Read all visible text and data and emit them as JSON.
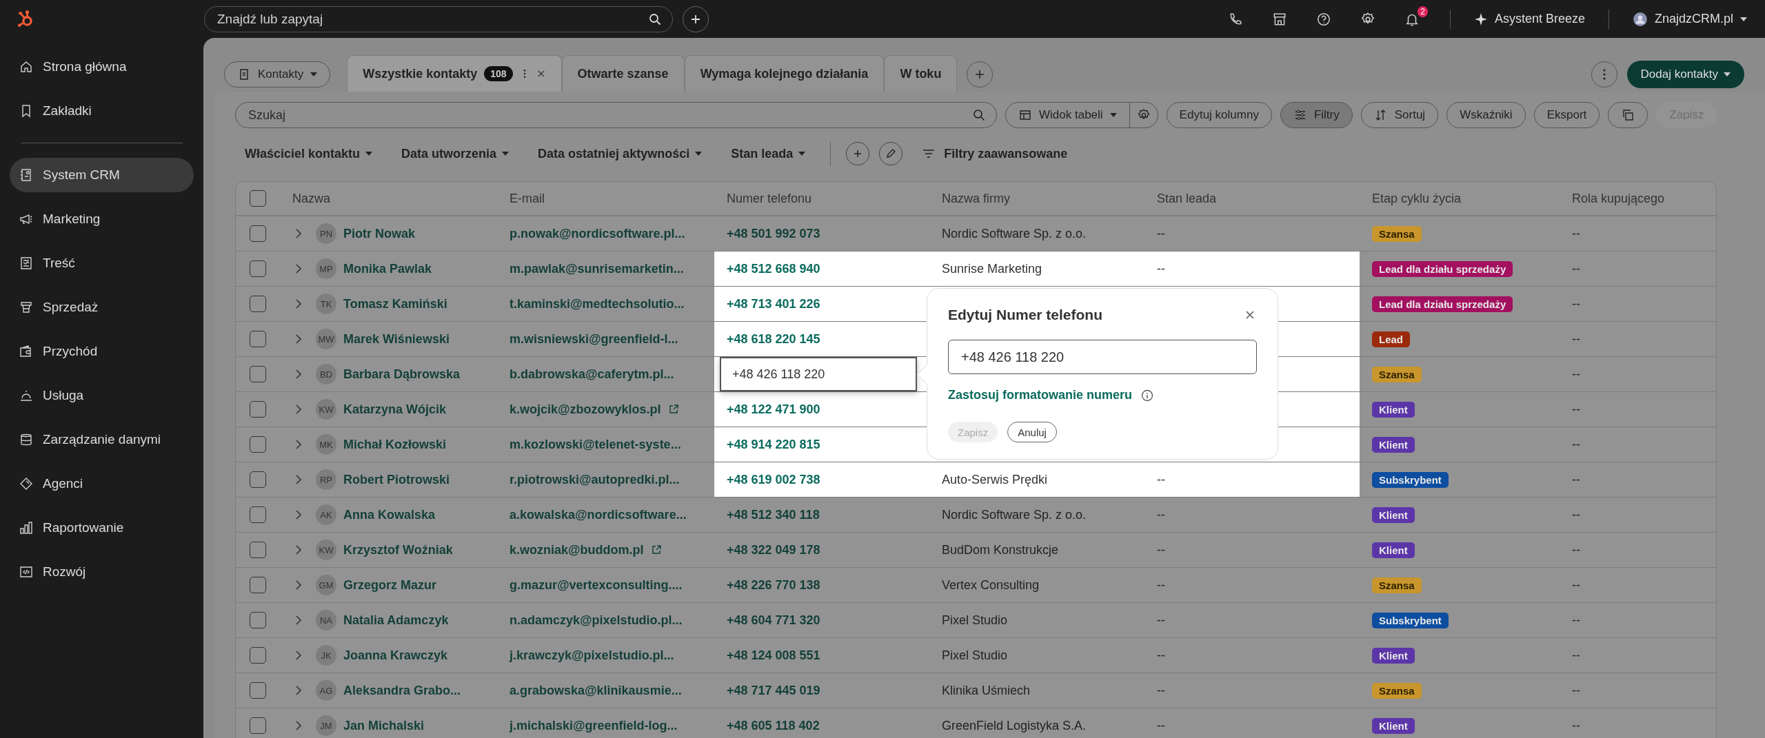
{
  "top_bar": {
    "search": {
      "placeholder": "Znajdź lub zapytaj"
    },
    "notifications": "2",
    "assistant": "Asystent Breeze",
    "account": "ZnajdzCRM.pl"
  },
  "sidebar": {
    "top_items": [
      {
        "label": "Strona główna",
        "selected": false
      },
      {
        "label": "Zakładki",
        "selected": false
      }
    ],
    "items": [
      {
        "label": "System CRM",
        "selected": true
      },
      {
        "label": "Marketing",
        "selected": false
      },
      {
        "label": "Treść",
        "selected": false
      },
      {
        "label": "Sprzedaż",
        "selected": false
      },
      {
        "label": "Przychód",
        "selected": false
      },
      {
        "label": "Usługa",
        "selected": false
      },
      {
        "label": "Zarządzanie danymi",
        "selected": false
      },
      {
        "label": "Agenci",
        "selected": false
      },
      {
        "label": "Raportowanie",
        "selected": false
      },
      {
        "label": "Rozwój",
        "selected": false
      }
    ]
  },
  "object_selector": "Kontakty",
  "tabs": [
    {
      "label": "Wszystkie kontakty",
      "count": "108",
      "selected": true
    },
    {
      "label": "Otwarte szanse",
      "selected": false
    },
    {
      "label": "Wymaga kolejnego działania",
      "selected": false
    },
    {
      "label": "W toku",
      "selected": false
    }
  ],
  "add_button": "Dodaj kontakty",
  "toolbar": {
    "search": {
      "placeholder": "Szukaj"
    },
    "view": "Widok tabeli",
    "buttons": [
      {
        "label": "Edytuj kolumny",
        "selected": false
      },
      {
        "label": "Filtry",
        "selected": true
      },
      {
        "label": "Sortuj",
        "selected": false
      },
      {
        "label": "Wskaźniki",
        "selected": false
      },
      {
        "label": "Eksport",
        "selected": false
      }
    ],
    "save": {
      "label": "Zapisz",
      "disabled": true
    }
  },
  "filters": [
    "Właściciel kontaktu",
    "Data utworzenia",
    "Data ostatniej aktywności",
    "Stan leada"
  ],
  "advanced_filters": "Filtry zaawansowane",
  "table": {
    "select_all_checked": false,
    "columns": [
      "Nazwa",
      "E-mail",
      "Numer telefonu",
      "Nazwa firmy",
      "Stan leada",
      "Etap cyklu życia",
      "Rola kupującego"
    ],
    "rows": [
      {
        "checked": false,
        "initials": "PN",
        "name": "Piotr Nowak",
        "email": "p.nowak@nordicsoftware.pl...",
        "external": false,
        "phone": "+48 501 992 073",
        "company": "Nordic Software Sp. z o.o.",
        "lead_status": "--",
        "stage": {
          "label": "Szansa",
          "color": "#c8962c"
        },
        "role": "--",
        "highlighted": false,
        "editing": false
      },
      {
        "checked": false,
        "initials": "MP",
        "name": "Monika Pawlak",
        "email": "m.pawlak@sunrisemarketin...",
        "external": false,
        "phone": "+48 512 668 940",
        "company": "Sunrise Marketing",
        "lead_status": "--",
        "stage": {
          "label": "Lead dla działu sprzedaży",
          "color": "#a3105f"
        },
        "role": "--",
        "highlighted": true,
        "editing": false
      },
      {
        "checked": false,
        "initials": "TK",
        "name": "Tomasz Kamiński",
        "email": "t.kaminski@medtechsolutio...",
        "external": false,
        "phone": "+48 713 401 226",
        "stage": {
          "label": "Lead dla działu sprzedaży",
          "color": "#a3105f"
        },
        "role": "--",
        "highlighted": true,
        "editing": false
      },
      {
        "checked": false,
        "initials": "MW",
        "name": "Marek Wiśniewski",
        "email": "m.wisniewski@greenfield-l...",
        "external": false,
        "phone": "+48 618 220 145",
        "stage": {
          "label": "Lead",
          "color": "#9b2a0c"
        },
        "role": "--",
        "highlighted": true,
        "editing": false
      },
      {
        "checked": false,
        "initials": "BD",
        "name": "Barbara Dąbrowska",
        "email": "b.dabrowska@caferytm.pl...",
        "external": false,
        "phone": "+48 426 118 220",
        "stage": {
          "label": "Szansa",
          "color": "#c8962c"
        },
        "role": "--",
        "highlighted": true,
        "editing": true
      },
      {
        "checked": false,
        "initials": "KW",
        "name": "Katarzyna Wójcik",
        "email": "k.wojcik@zbozowyklos.pl",
        "external": true,
        "phone": "+48 122 471 900",
        "stage": {
          "label": "Klient",
          "color": "#5c36a8"
        },
        "role": "--",
        "highlighted": true,
        "editing": false
      },
      {
        "checked": false,
        "initials": "MK",
        "name": "Michał Kozłowski",
        "email": "m.kozlowski@telenet-syste...",
        "external": false,
        "phone": "+48 914 220 815",
        "stage": {
          "label": "Klient",
          "color": "#5c36a8"
        },
        "role": "--",
        "highlighted": true,
        "editing": false
      },
      {
        "checked": false,
        "initials": "RP",
        "name": "Robert Piotrowski",
        "email": "r.piotrowski@autopredki.pl...",
        "external": false,
        "phone": "+48 619 002 738",
        "company": "Auto-Serwis Prędki",
        "lead_status": "--",
        "stage": {
          "label": "Subskrybent",
          "color": "#0d4ea0"
        },
        "role": "--",
        "highlighted": true,
        "editing": false
      },
      {
        "checked": false,
        "initials": "AK",
        "name": "Anna Kowalska",
        "email": "a.kowalska@nordicsoftware...",
        "external": false,
        "phone": "+48 512 340 118",
        "company": "Nordic Software Sp. z o.o.",
        "lead_status": "--",
        "stage": {
          "label": "Klient",
          "color": "#5c36a8"
        },
        "role": "--",
        "highlighted": false,
        "editing": false
      },
      {
        "checked": false,
        "initials": "KW",
        "name": "Krzysztof Woźniak",
        "email": "k.wozniak@buddom.pl",
        "external": true,
        "phone": "+48 322 049 178",
        "company": "BudDom Konstrukcje",
        "lead_status": "--",
        "stage": {
          "label": "Klient",
          "color": "#5c36a8"
        },
        "role": "--",
        "highlighted": false,
        "editing": false
      },
      {
        "checked": false,
        "initials": "GM",
        "name": "Grzegorz Mazur",
        "email": "g.mazur@vertexconsulting....",
        "external": false,
        "phone": "+48 226 770 138",
        "company": "Vertex Consulting",
        "lead_status": "--",
        "stage": {
          "label": "Szansa",
          "color": "#c8962c"
        },
        "role": "--",
        "highlighted": false,
        "editing": false
      },
      {
        "checked": false,
        "initials": "NA",
        "name": "Natalia Adamczyk",
        "email": "n.adamczyk@pixelstudio.pl...",
        "external": false,
        "phone": "+48 604 771 320",
        "company": "Pixel Studio",
        "lead_status": "--",
        "stage": {
          "label": "Subskrybent",
          "color": "#0d4ea0"
        },
        "role": "--",
        "highlighted": false,
        "editing": false
      },
      {
        "checked": false,
        "initials": "JK",
        "name": "Joanna Krawczyk",
        "email": "j.krawczyk@pixelstudio.pl...",
        "external": false,
        "phone": "+48 124 008 551",
        "company": "Pixel Studio",
        "lead_status": "--",
        "stage": {
          "label": "Klient",
          "color": "#5c36a8"
        },
        "role": "--",
        "highlighted": false,
        "editing": false
      },
      {
        "checked": false,
        "initials": "AG",
        "name": "Aleksandra Grabo...",
        "email": "a.grabowska@klinikausmie...",
        "external": false,
        "phone": "+48 717 445 019",
        "company": "Klinika Uśmiech",
        "lead_status": "--",
        "stage": {
          "label": "Szansa",
          "color": "#c8962c"
        },
        "role": "--",
        "highlighted": false,
        "editing": false
      },
      {
        "checked": false,
        "initials": "JM",
        "name": "Jan Michalski",
        "email": "j.michalski@greenfield-log...",
        "external": false,
        "phone": "+48 605 118 402",
        "company": "GreenField Logistyka S.A.",
        "lead_status": "--",
        "stage": {
          "label": "Klient",
          "color": "#5c36a8"
        },
        "role": "--",
        "highlighted": false,
        "editing": false
      }
    ]
  },
  "popover": {
    "title": "Edytuj Numer telefonu",
    "value": "+48 426 118 220",
    "format_link": "Zastosuj formatowanie numeru",
    "save": {
      "label": "Zapisz",
      "disabled": true
    },
    "cancel": "Anuluj"
  }
}
